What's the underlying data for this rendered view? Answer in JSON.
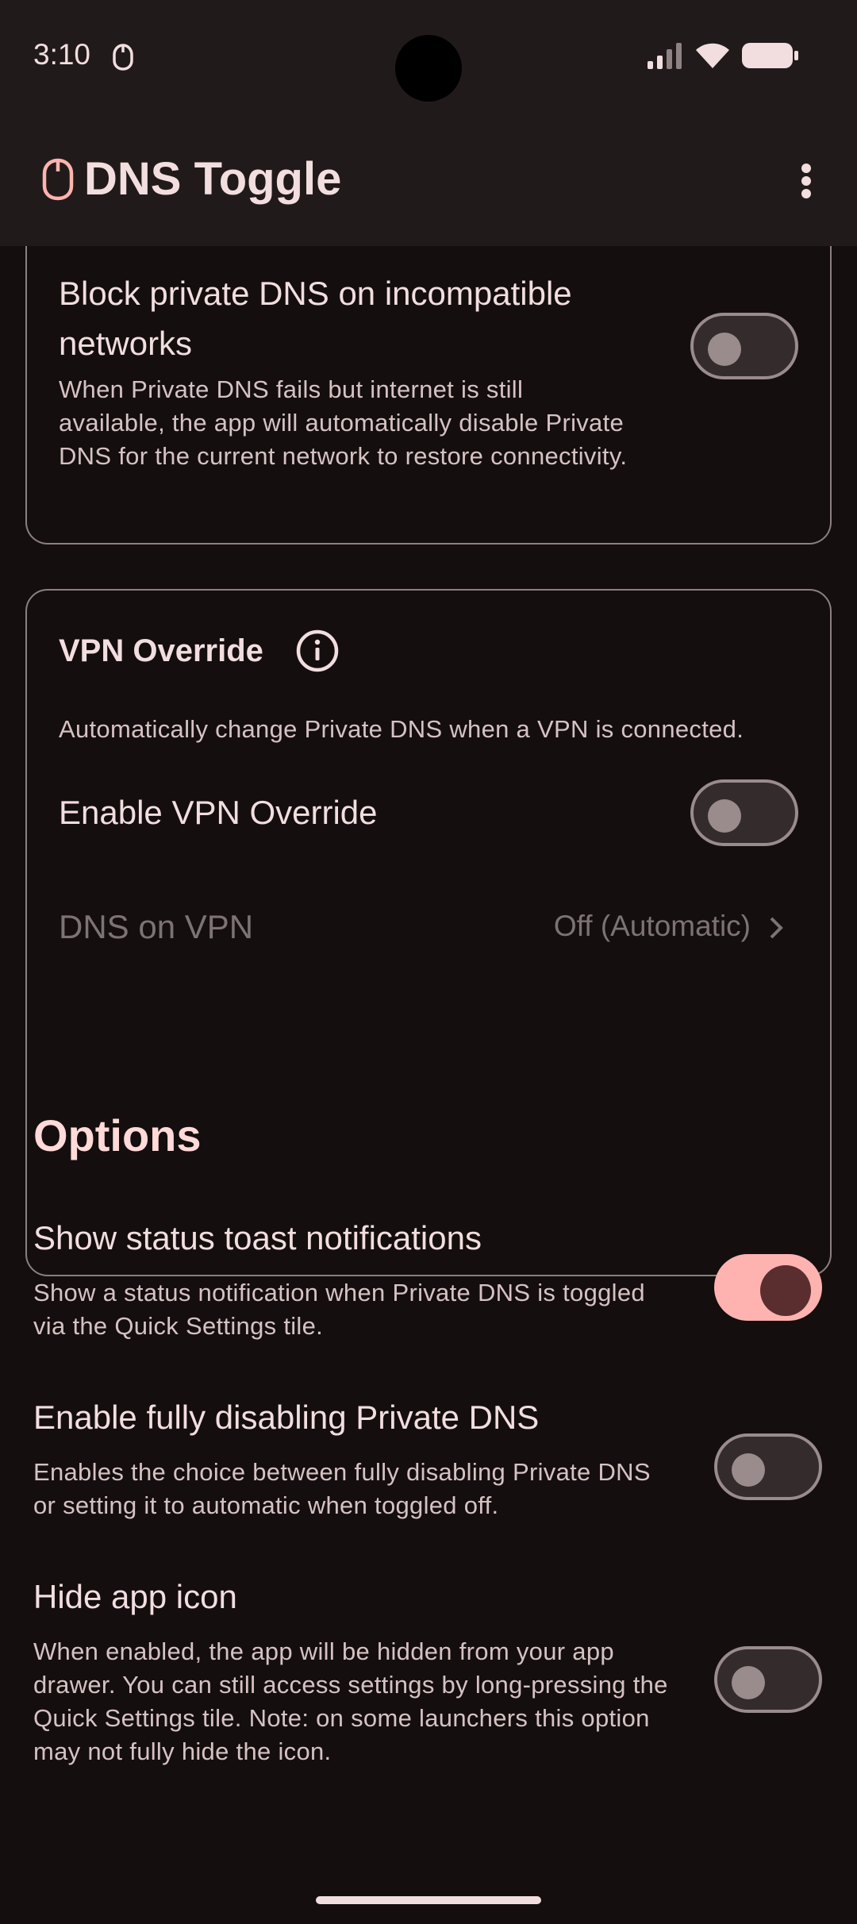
{
  "status_bar": {
    "time": "3:10",
    "icons": [
      "notification-app-icon",
      "signal-icon",
      "wifi-icon",
      "battery-icon"
    ]
  },
  "app_bar": {
    "title": "DNS Toggle",
    "logo_icon": "shield-icon",
    "menu_icon": "more-vert-icon"
  },
  "block_card": {
    "title": "Block private DNS on incompatible networks",
    "description": "When Private DNS fails but internet is still available, the app will automatically disable Private DNS for the current network to restore connectivity.",
    "enabled": false
  },
  "vpn_card": {
    "title": "VPN Override",
    "info_icon": "info-icon",
    "description": "Automatically change Private DNS when a VPN is connected.",
    "enable_label": "Enable VPN Override",
    "enable_on": false,
    "dns_on_vpn_label": "DNS on VPN",
    "dns_on_vpn_value": "Off (Automatic)"
  },
  "options": {
    "heading": "Options",
    "items": [
      {
        "title": "Show status toast notifications",
        "description": "Show a status notification when Private DNS is toggled via the Quick Settings tile.",
        "enabled": true
      },
      {
        "title": "Enable fully disabling Private DNS",
        "description": "Enables the choice between fully disabling Private DNS or setting it to automatic when toggled off.",
        "enabled": false
      },
      {
        "title": "Hide app icon",
        "description": "When enabled, the app will be hidden from your app drawer. You can still access settings by long-pressing the Quick Settings tile. Note: on some launchers this option may not fully hide the icon.",
        "enabled": false
      }
    ]
  },
  "colors": {
    "background": "#140e0f",
    "accent": "#ffb3b0",
    "outline": "#8c7f80"
  }
}
